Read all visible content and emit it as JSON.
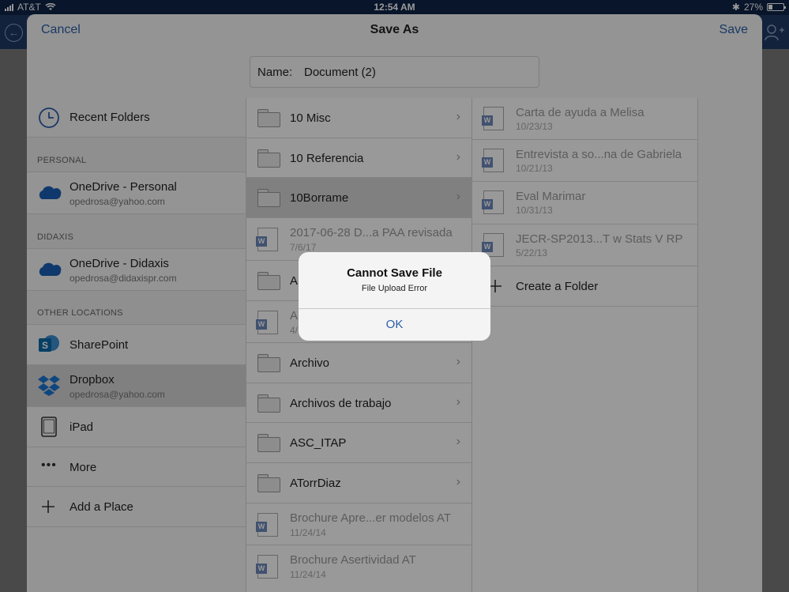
{
  "status_bar": {
    "carrier": "AT&T",
    "time": "12:54 AM",
    "battery": "27%"
  },
  "sheet": {
    "cancel_label": "Cancel",
    "title": "Save As",
    "save_label": "Save",
    "name_label": "Name:",
    "name_value": "Document (2)"
  },
  "locations": {
    "recent": "Recent Folders",
    "sections": [
      "PERSONAL",
      "DIDAXIS",
      "OTHER LOCATIONS"
    ],
    "onedrive_personal": {
      "title": "OneDrive - Personal",
      "email": "opedrosa@yahoo.com"
    },
    "onedrive_didaxis": {
      "title": "OneDrive - Didaxis",
      "email": "opedrosa@didaxispr.com"
    },
    "sharepoint": "SharePoint",
    "dropbox": {
      "title": "Dropbox",
      "email": "opedrosa@yahoo.com"
    },
    "ipad": "iPad",
    "more": "More",
    "add_place": "Add a Place"
  },
  "folder_list": [
    {
      "type": "folder",
      "name": "10 Misc"
    },
    {
      "type": "folder",
      "name": "10 Referencia"
    },
    {
      "type": "folder",
      "name": "10Borrame",
      "selected": true
    },
    {
      "type": "doc",
      "name": "2017-06-28 D...a PAA revisada",
      "date": "7/6/17"
    },
    {
      "type": "folder",
      "name": "A"
    },
    {
      "type": "doc",
      "name": "A",
      "date": "4/"
    },
    {
      "type": "folder",
      "name": "Archivo"
    },
    {
      "type": "folder",
      "name": "Archivos de trabajo"
    },
    {
      "type": "folder",
      "name": "ASC_ITAP"
    },
    {
      "type": "folder",
      "name": "ATorrDiaz"
    },
    {
      "type": "doc",
      "name": "Brochure Apre...er modelos AT",
      "date": "11/24/14"
    },
    {
      "type": "doc",
      "name": "Brochure Asertividad AT",
      "date": "11/24/14"
    }
  ],
  "file_list": [
    {
      "name": "Carta de ayuda a Melisa",
      "date": "10/23/13"
    },
    {
      "name": "Entrevista a so...na de Gabriela",
      "date": "10/21/13"
    },
    {
      "name": "Eval Marimar",
      "date": "10/31/13"
    },
    {
      "name": "JECR-SP2013...T w Stats V RP",
      "date": "5/22/13"
    }
  ],
  "create_folder": "Create a Folder",
  "alert": {
    "title": "Cannot Save File",
    "message": "File Upload Error",
    "ok": "OK"
  },
  "colors": {
    "accent": "#2c5ea8",
    "app_bar": "#1f3a66",
    "onedrive": "#1a5fb4",
    "sharepoint": "#0b6aa8",
    "dropbox": "#1b76d2"
  }
}
